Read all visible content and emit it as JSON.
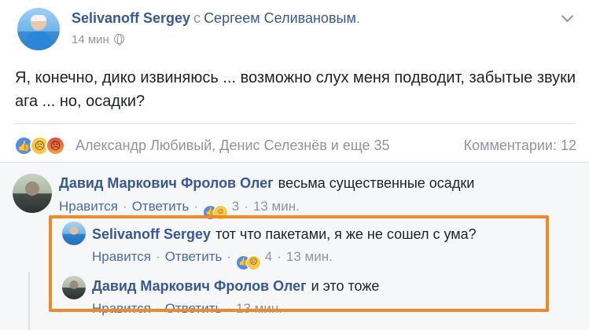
{
  "post": {
    "author": "Selivanoff Sergey",
    "with_word": "с",
    "tagged": "Сергеем Селивановым",
    "tagged_suffix": ".",
    "time": "14 мин",
    "text": "Я, конечно, дико извиняюсь ... возможно слух меня подводит, забытые звуки ага ... но, осадки?",
    "reactors": "Александр Любивый, Денис Селезнёв и еще 35",
    "comments_count": "Комментарии: 12"
  },
  "reaction_icons": [
    "like-icon",
    "sad-icon",
    "angry-icon"
  ],
  "comments": [
    {
      "name": "Давид Маркович Фролов Олег",
      "text": "весьма существенные осадки",
      "like": "Нравится",
      "reply": "Ответить",
      "reactions_count": "3",
      "time": "13 мин."
    },
    {
      "name": "Selivanoff Sergey",
      "text": "тот что пакетами, я же не сошел с ума?",
      "like": "Нравится",
      "reply": "Ответить",
      "reactions_count": "4",
      "time": "13 мин."
    },
    {
      "name": "Давид Маркович Фролов Олег",
      "text": "и это тоже",
      "like": "Нравится",
      "reply": "Ответить",
      "time": "13 мин."
    }
  ],
  "colors": {
    "link": "#365899",
    "muted": "#90949c",
    "highlight_border": "#f08a24",
    "comments_bg": "#f6f7f9"
  }
}
